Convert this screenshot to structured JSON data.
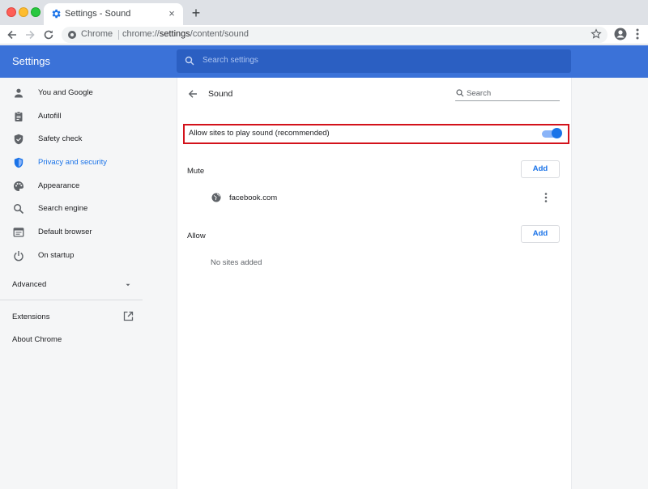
{
  "window": {
    "tab_title": "Settings - Sound",
    "tab_close": "×",
    "new_tab": "+"
  },
  "toolbar": {
    "site_chip": "Chrome",
    "url_prefix": "chrome://",
    "url_bold": "settings",
    "url_suffix": "/content/sound"
  },
  "header": {
    "title": "Settings",
    "search_placeholder": "Search settings"
  },
  "sidebar": {
    "items": [
      {
        "label": "You and Google",
        "icon": "person-icon"
      },
      {
        "label": "Autofill",
        "icon": "clipboard-icon"
      },
      {
        "label": "Safety check",
        "icon": "shield-check-icon"
      },
      {
        "label": "Privacy and security",
        "icon": "shield-icon",
        "active": true
      },
      {
        "label": "Appearance",
        "icon": "palette-icon"
      },
      {
        "label": "Search engine",
        "icon": "search-icon"
      },
      {
        "label": "Default browser",
        "icon": "browser-icon"
      },
      {
        "label": "On startup",
        "icon": "power-icon"
      }
    ],
    "advanced": "Advanced",
    "extensions": "Extensions",
    "about": "About Chrome"
  },
  "sound": {
    "title": "Sound",
    "search_label": "Search",
    "toggle_label": "Allow sites to play sound (recommended)",
    "toggle_on": true,
    "mute_label": "Mute",
    "allow_label": "Allow",
    "add_label": "Add",
    "muted_sites": [
      "facebook.com"
    ],
    "allowed_empty": "No sites added"
  },
  "colors": {
    "header_blue": "#3b72d8",
    "accent": "#1a73e8",
    "highlight_red": "#d3121b"
  }
}
